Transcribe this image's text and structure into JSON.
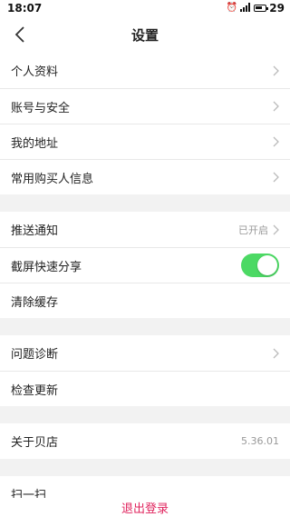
{
  "status_bar": {
    "time": "18:07",
    "battery": "29"
  },
  "header": {
    "title": "设置"
  },
  "groups": [
    {
      "items": [
        {
          "label": "个人资料"
        },
        {
          "label": "账号与安全"
        },
        {
          "label": "我的地址"
        },
        {
          "label": "常用购买人信息"
        }
      ]
    },
    {
      "items": [
        {
          "label": "推送通知",
          "value": "已开启"
        },
        {
          "label": "截屏快速分享",
          "toggle_on": true
        },
        {
          "label": "清除缓存"
        }
      ]
    },
    {
      "items": [
        {
          "label": "问题诊断"
        },
        {
          "label": "检查更新"
        }
      ]
    },
    {
      "items": [
        {
          "label": "关于贝店",
          "value": "5.36.01"
        }
      ]
    },
    {
      "items": [
        {
          "label": "扫一扫"
        }
      ]
    }
  ],
  "logout_label": "退出登录",
  "colors": {
    "toggle_on": "#4cd964",
    "logout": "#e0245e"
  }
}
